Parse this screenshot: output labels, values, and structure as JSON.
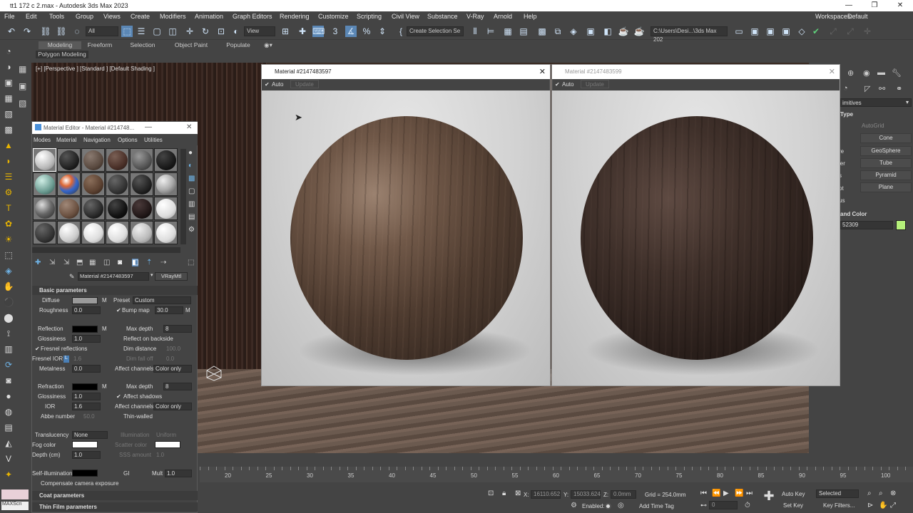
{
  "app": {
    "title": "tt1 172 c 2.max - Autodesk 3ds Max 2023",
    "workspace_label": "Workspaces:",
    "workspace_value": "Default"
  },
  "menu": [
    "File",
    "Edit",
    "Tools",
    "Group",
    "Views",
    "Create",
    "Modifiers",
    "Animation",
    "Graph Editors",
    "Rendering",
    "Customize",
    "Scripting",
    "Civil View",
    "Substance",
    "V-Ray",
    "Arnold",
    "Help"
  ],
  "toolbar": {
    "filter": "All",
    "view": "View",
    "create_selection": "Create Selection Se",
    "path": "C:\\Users\\Desi...\\3ds Max 202"
  },
  "ribbon": {
    "tabs": [
      "Modeling",
      "Freeform",
      "Selection",
      "Object Paint",
      "Populate"
    ],
    "sub": "Polygon Modeling"
  },
  "viewport": {
    "label": "[+] [Perspective ] [Standard ] [Default Shading ]"
  },
  "preview1": {
    "title": "Material #2147483597",
    "auto": "Auto",
    "update": "Update"
  },
  "preview2": {
    "title": "Material #2147483599",
    "auto": "Auto",
    "update": "Update"
  },
  "material_editor": {
    "title": "Material Editor - Material #214748...",
    "menus": [
      "Modes",
      "Material",
      "Navigation",
      "Options",
      "Utilities"
    ],
    "material_name": "Material #2147483597",
    "material_type": "VRayMtl",
    "basic_params": "Basic parameters",
    "diffuse": "Diffuse",
    "m": "M",
    "preset": "Preset",
    "preset_value": "Custom",
    "roughness": "Roughness",
    "roughness_val": "0.0",
    "bump_map": "Bump map",
    "bump_val": "30.0",
    "reflection": "Reflection",
    "max_depth": "Max depth",
    "max_depth_val": "8",
    "glossiness": "Glossiness",
    "gloss_val": "1.0",
    "reflect_backside": "Reflect on backside",
    "fresnel": "Fresnel reflections",
    "dim_distance": "Dim distance",
    "dim_distance_val": "100.0",
    "fresnel_ior": "Fresnel IOR",
    "fresnel_ior_val": "1.6",
    "dim_falloff": "Dim fall off",
    "dim_falloff_val": "0.0",
    "metalness": "Metalness",
    "metal_val": "0.0",
    "affect_channels": "Affect channels",
    "color_only": "Color only",
    "refraction": "Refraction",
    "rmax_depth_val": "8",
    "rgloss_val": "1.0",
    "affect_shadows": "Affect shadows",
    "ior": "IOR",
    "ior_val": "1.6",
    "abbe": "Abbe number",
    "abbe_val": "50.0",
    "thin_walled": "Thin-walled",
    "translucency": "Translucency",
    "transl_val": "None",
    "illumination": "Illumination",
    "illum_val": "Uniform",
    "fog_color": "Fog color",
    "scatter_color": "Scatter color",
    "depth": "Depth (cm)",
    "depth_val": "1.0",
    "sss_amount": "SSS amount",
    "sss_val": "1.0",
    "self_illum": "Self-illumination",
    "gi": "GI",
    "mult": "Mult",
    "mult_val": "1.0",
    "compensate": "Compensate camera exposure",
    "coat": "Coat parameters",
    "thin_film": "Thin Film parameters"
  },
  "side_panel": {
    "dropdown": "imitives",
    "type": "Type",
    "autogrid": "AutoGrid",
    "left_cut": [
      "re",
      "ler",
      "s",
      "ot",
      "us"
    ],
    "buttons": [
      "Cone",
      "GeoSphere",
      "Tube",
      "Pyramid",
      "Plane"
    ],
    "name_color": "and Color",
    "name_value": "52309",
    "swatch_color": "#b5f07a"
  },
  "timeline": {
    "ticks": [
      "20",
      "25",
      "30",
      "35",
      "40",
      "45",
      "50",
      "55",
      "60",
      "65",
      "70",
      "75",
      "80",
      "85",
      "90",
      "95",
      "100"
    ]
  },
  "status": {
    "x": "X:",
    "x_val": "16110.652",
    "y": "Y:",
    "y_val": "15033.624",
    "z": "Z:",
    "z_val": "0.0mm",
    "grid": "Grid = 254.0mm",
    "enabled": "Enabled:",
    "add_time_tag": "Add Time Tag",
    "auto_key": "Auto Key",
    "selected": "Selected",
    "set_key": "Set Key",
    "key_filters": "Key Filters...",
    "frame": "0",
    "maxscript": "MAXScri"
  }
}
